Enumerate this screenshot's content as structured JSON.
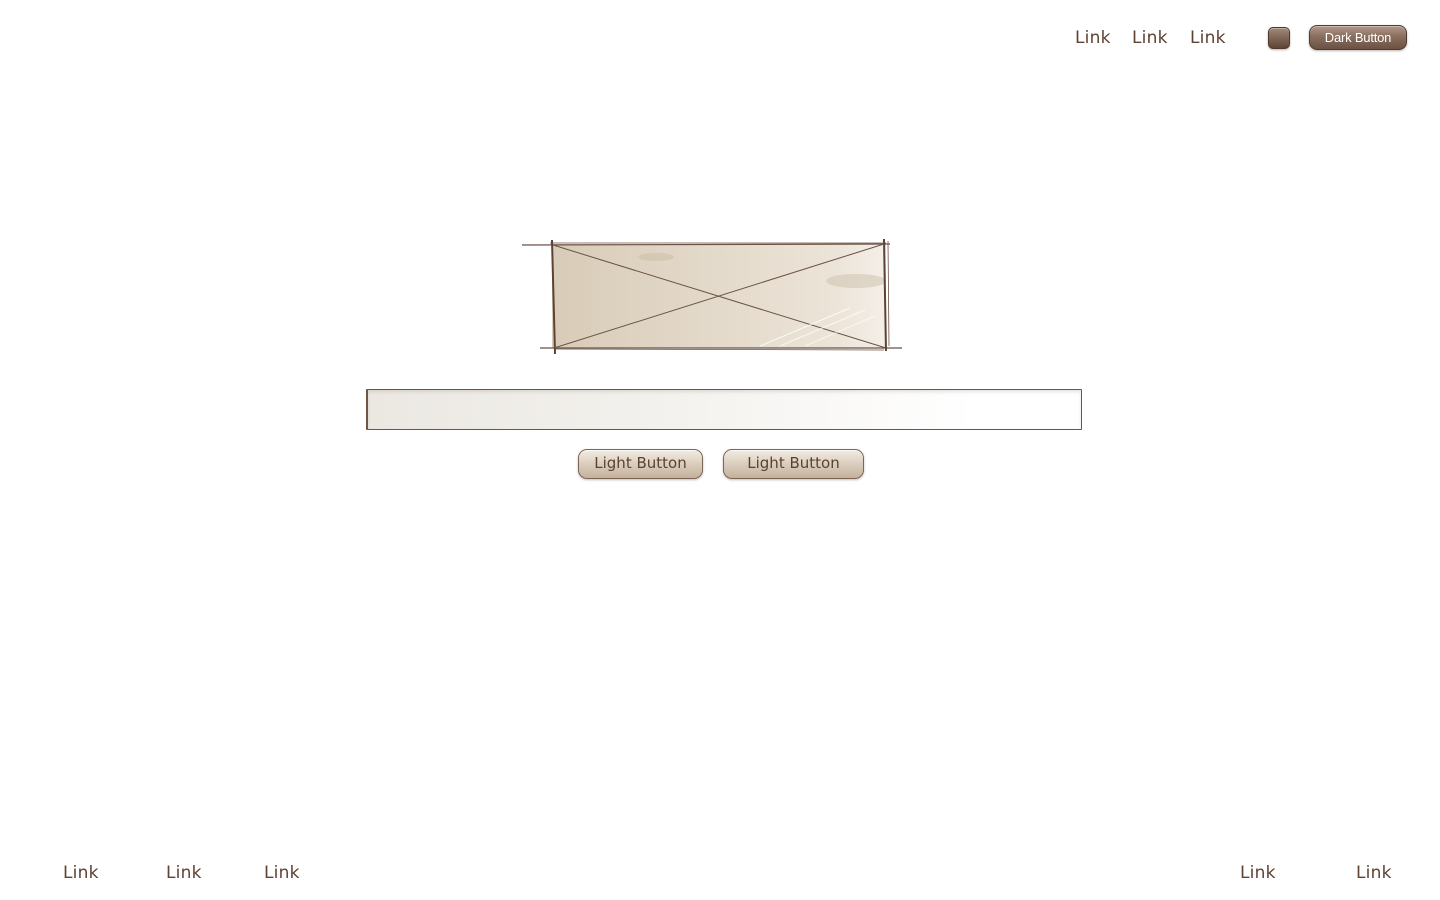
{
  "header": {
    "nav_links": [
      "Link",
      "Link",
      "Link"
    ],
    "dark_button_label": "Dark Button"
  },
  "main": {
    "search": {
      "value": "",
      "placeholder": ""
    },
    "buttons": [
      "Light Button",
      "Light Button"
    ]
  },
  "footer": {
    "left_links": [
      "Link",
      "Link",
      "Link"
    ],
    "right_links": [
      "Link",
      "Link"
    ]
  },
  "colors": {
    "text": "#5e4232",
    "accent_dark": "#7c6252",
    "accent_light": "#ddd0c0",
    "background": "#ffffff"
  },
  "icons": {
    "image_placeholder": "image-placeholder-icon",
    "square_button": "square-button"
  }
}
